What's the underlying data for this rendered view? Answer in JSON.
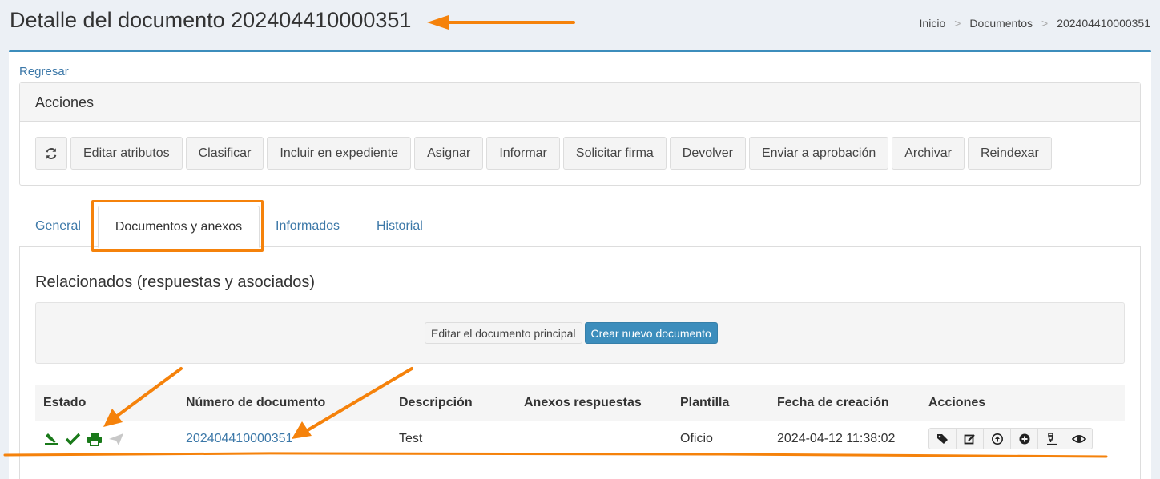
{
  "header": {
    "title": "Detalle del documento 202404410000351",
    "breadcrumb": [
      "Inicio",
      "Documentos",
      "202404410000351"
    ]
  },
  "back_link": "Regresar",
  "actions_panel": {
    "title": "Acciones",
    "refresh_icon": "refresh-icon",
    "buttons": [
      "Editar atributos",
      "Clasificar",
      "Incluir en expediente",
      "Asignar",
      "Informar",
      "Solicitar firma",
      "Devolver",
      "Enviar a aprobación",
      "Archivar",
      "Reindexar"
    ]
  },
  "tabs": [
    {
      "label": "General",
      "active": false
    },
    {
      "label": "Documentos y anexos",
      "active": true
    },
    {
      "label": "Informados",
      "active": false
    },
    {
      "label": "Historial",
      "active": false
    }
  ],
  "related": {
    "title": "Relacionados (respuestas y asociados)",
    "edit_main_label": "Editar el documento principal",
    "create_new_label": "Crear nuevo documento"
  },
  "table": {
    "headers": [
      "Estado",
      "Número de documento",
      "Descripción",
      "Anexos respuestas",
      "Plantilla",
      "Fecha de creación",
      "Acciones"
    ],
    "rows": [
      {
        "estado_icons": [
          "stamp-icon",
          "check-icon",
          "print-icon",
          "send-icon"
        ],
        "numero": "202404410000351",
        "descripcion": "Test",
        "anexos": "",
        "plantilla": "Oficio",
        "fecha": "2024-04-12 11:38:02",
        "acciones_icons": [
          "tags-icon",
          "edit-icon",
          "upload-icon",
          "add-icon",
          "sign-icon",
          "view-icon"
        ]
      }
    ]
  },
  "colors": {
    "accent": "#3c8dbc",
    "annotation": "#f5820b",
    "status_green": "#1a7a1a",
    "link": "#3c78a8"
  }
}
